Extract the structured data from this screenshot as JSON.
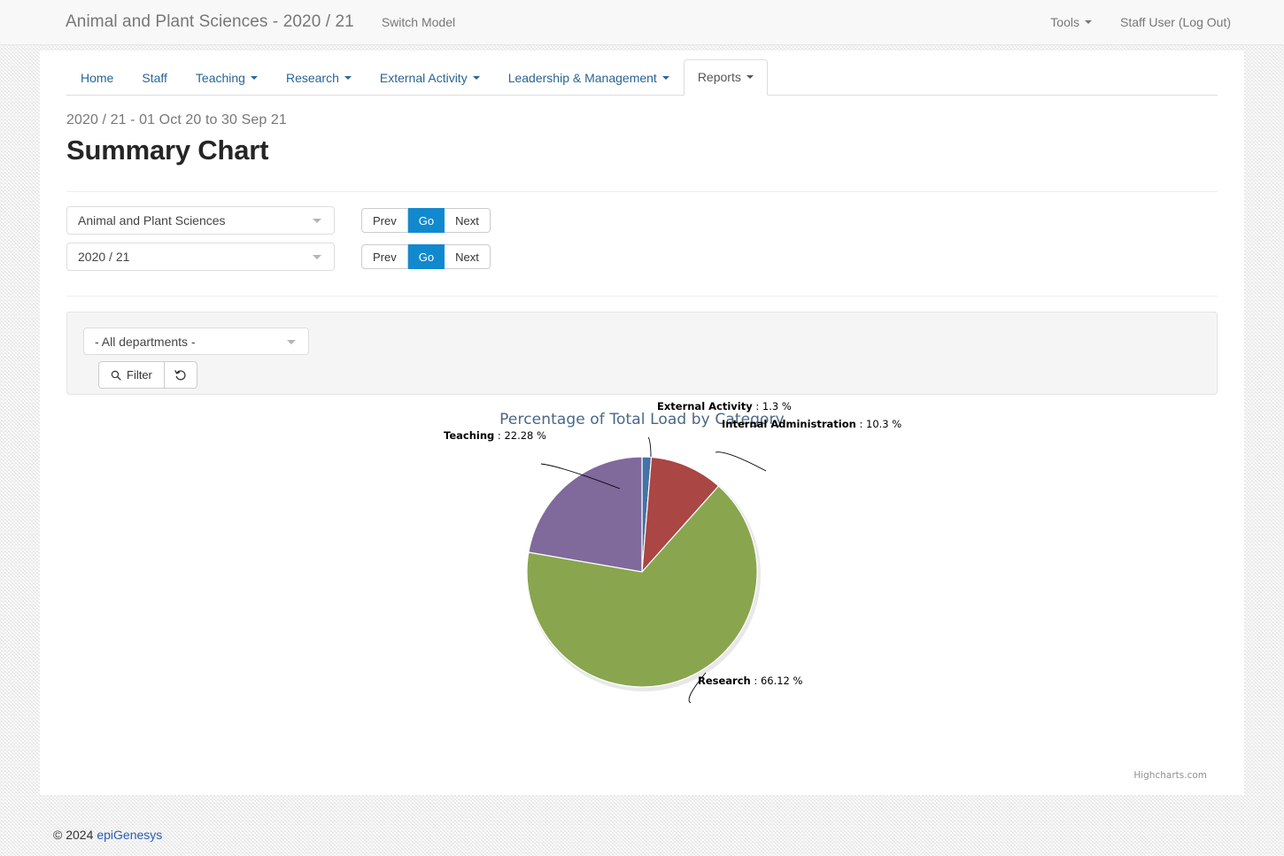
{
  "topbar": {
    "brand": "Animal and Plant Sciences - 2020 / 21",
    "switch_model": "Switch Model",
    "tools": "Tools",
    "user": "Staff User (Log Out)"
  },
  "tabs": [
    {
      "label": "Home",
      "caret": false,
      "active": false
    },
    {
      "label": "Staff",
      "caret": false,
      "active": false
    },
    {
      "label": "Teaching",
      "caret": true,
      "active": false
    },
    {
      "label": "Research",
      "caret": true,
      "active": false
    },
    {
      "label": "External Activity",
      "caret": true,
      "active": false
    },
    {
      "label": "Leadership & Management",
      "caret": true,
      "active": false
    },
    {
      "label": "Reports",
      "caret": true,
      "active": true
    }
  ],
  "heading": {
    "daterange": "2020 / 21 - 01 Oct 20 to 30 Sep 21",
    "title": "Summary Chart"
  },
  "selectors": {
    "department": {
      "value": "Animal and Plant Sciences"
    },
    "year": {
      "value": "2020 / 21"
    },
    "buttons": {
      "prev": "Prev",
      "go": "Go",
      "next": "Next"
    }
  },
  "filter": {
    "department_select": "- All departments -",
    "filter_button": "Filter",
    "reset_button": ""
  },
  "chart_data": {
    "type": "pie",
    "title": "Percentage of Total Load by Category",
    "title_color": "#4a6785",
    "credit": "Highcharts.com",
    "unit": "%",
    "labels": [
      "Teaching",
      "External Activity",
      "Internal Administration",
      "Research"
    ],
    "values": [
      22.28,
      1.3,
      10.3,
      66.12
    ],
    "value_texts": [
      "22.28 %",
      "1.3 %",
      "10.3 %",
      "66.12 %"
    ],
    "colors": [
      "#80699B",
      "#4572A7",
      "#AA4643",
      "#89A54E"
    ],
    "slices": [
      {
        "name": "Teaching",
        "value": 22.28,
        "text": "22.28 %",
        "color": "#80699B"
      },
      {
        "name": "External Activity",
        "value": 1.3,
        "text": "1.3 %",
        "color": "#4572A7"
      },
      {
        "name": "Internal Administration",
        "value": 10.3,
        "text": "10.3 %",
        "color": "#AA4643"
      },
      {
        "name": "Research",
        "value": 66.12,
        "text": "66.12 %",
        "color": "#89A54E"
      }
    ],
    "legend": false,
    "separator": " : "
  },
  "footer": {
    "copyright": "© 2024",
    "company": "epiGenesys"
  }
}
